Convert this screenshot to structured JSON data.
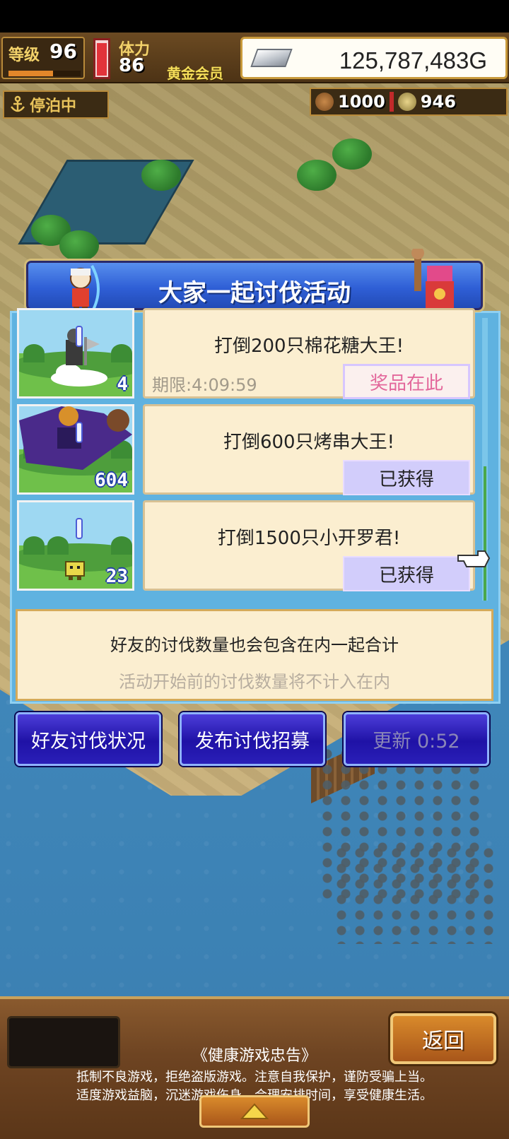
{
  "hud": {
    "level_label": "等级",
    "level": "96",
    "stamina_label": "体力",
    "stamina": "86",
    "membership": "黄金会员",
    "gold": "125,787,483G",
    "dock_status": "停泊中",
    "resource_1": "1000",
    "resource_2": "946"
  },
  "event": {
    "title": "大家一起讨伐活动",
    "missions": [
      {
        "count": "4",
        "title": "打倒200只棉花糖大王!",
        "deadline": "期限:4:09:59",
        "button": "奖品在此"
      },
      {
        "count": "604",
        "title": "打倒600只烤串大王!",
        "button": "已获得"
      },
      {
        "count": "23",
        "title": "打倒1500只小开罗君!",
        "button": "已获得"
      }
    ],
    "note_main": "好友的讨伐数量也会包含在内一起合计",
    "note_sub": "活动开始前的讨伐数量将不计入在内",
    "actions": {
      "friends_status": "好友讨伐状况",
      "post_recruit": "发布讨伐招募",
      "refresh": "更新 0:52"
    }
  },
  "footer": {
    "back": "返回",
    "warning_title": "《健康游戏忠告》",
    "warning_line1": "抵制不良游戏，拒绝盗版游戏。注意自我保护，谨防受骗上当。",
    "warning_line2": "适度游戏益脑，沉迷游戏伤身。合理安排时间，享受健康生活。"
  },
  "colors": {
    "panel_blue": "#5fb2e0",
    "header_blue": "#2f5fd6",
    "card_bg": "#fbeed0",
    "claimed_button": "#d2cdfb",
    "prize_text": "#e3679b",
    "action_button": "#1f12a6"
  },
  "icons": [
    "gold-bar-icon",
    "anchor-icon",
    "wood-log-icon",
    "coin-icon",
    "pointing-hand-icon",
    "up-arrow-icon"
  ]
}
